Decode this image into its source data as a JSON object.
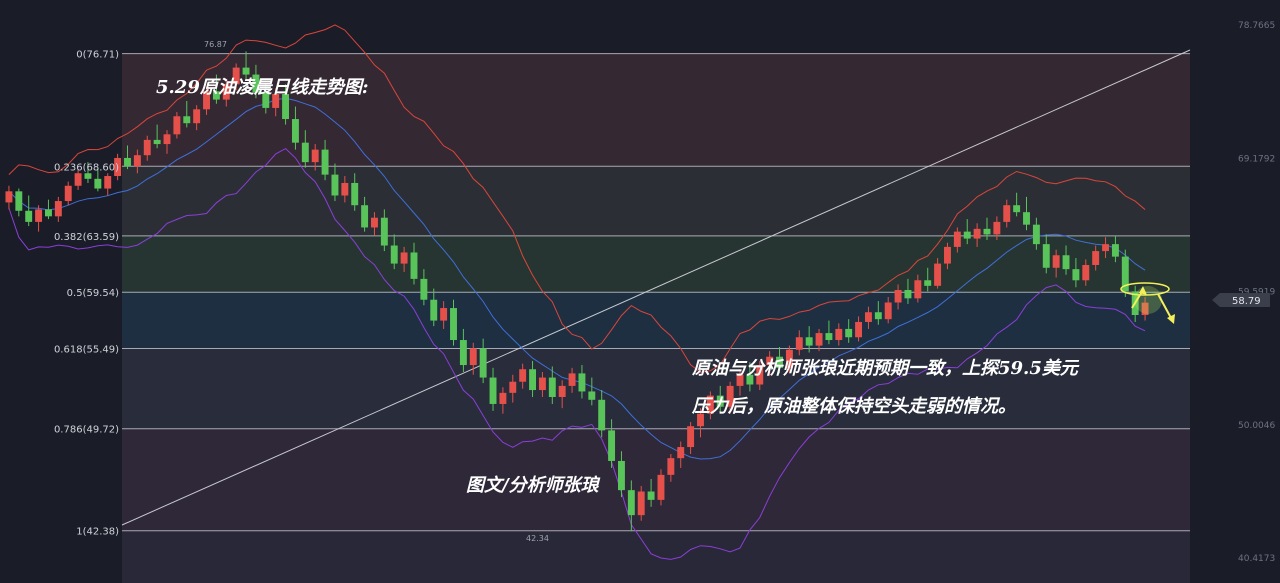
{
  "chart_data": {
    "type": "candlestick",
    "title": "5.29原油凌晨日线走势图:",
    "annotations": {
      "main_note_line1": "原油与分析师张琅近期预期一致，上探59.5美元",
      "main_note_line2": "压力后，原油整体保持空头走弱的情况。",
      "credit": "图文/分析师张琅",
      "high_label": "76.87",
      "low_label": "42.34"
    },
    "fib_levels": [
      {
        "label": "0(76.71)",
        "value": 76.71
      },
      {
        "label": "0.236(68.60)",
        "value": 68.6
      },
      {
        "label": "0.382(63.59)",
        "value": 63.59
      },
      {
        "label": "0.5(59.54)",
        "value": 59.54
      },
      {
        "label": "0.618(55.49)",
        "value": 55.49
      },
      {
        "label": "0.786(49.72)",
        "value": 49.72
      },
      {
        "label": "1(42.38)",
        "value": 42.38
      }
    ],
    "y_axis_ticks": [
      "78.7665",
      "69.1792",
      "59.5919",
      "50.0046",
      "40.4173"
    ],
    "y_tick_values": [
      78.7665,
      69.1792,
      59.5919,
      50.0046,
      40.4173
    ],
    "last_price": "58.79",
    "ylim": [
      40.4173,
      78.7665
    ],
    "candles": [
      [
        66.0,
        67.2,
        65.5,
        66.8
      ],
      [
        66.8,
        67.0,
        65.0,
        65.4
      ],
      [
        65.4,
        66.5,
        64.3,
        64.6
      ],
      [
        64.6,
        65.8,
        63.9,
        65.5
      ],
      [
        65.5,
        66.2,
        64.8,
        65.0
      ],
      [
        65.0,
        66.4,
        64.6,
        66.1
      ],
      [
        66.1,
        67.5,
        65.8,
        67.2
      ],
      [
        67.2,
        68.4,
        66.9,
        68.1
      ],
      [
        68.1,
        68.9,
        67.4,
        67.7
      ],
      [
        67.7,
        68.5,
        66.8,
        67.0
      ],
      [
        67.0,
        68.1,
        66.5,
        67.9
      ],
      [
        67.9,
        69.5,
        67.6,
        69.2
      ],
      [
        69.2,
        70.1,
        68.4,
        68.6
      ],
      [
        68.6,
        69.8,
        68.1,
        69.4
      ],
      [
        69.4,
        70.8,
        69.0,
        70.5
      ],
      [
        70.5,
        71.6,
        69.9,
        70.2
      ],
      [
        70.2,
        71.2,
        69.5,
        70.9
      ],
      [
        70.9,
        72.5,
        70.6,
        72.2
      ],
      [
        72.2,
        73.3,
        71.4,
        71.7
      ],
      [
        71.7,
        73.0,
        71.2,
        72.7
      ],
      [
        72.7,
        74.3,
        72.3,
        74.0
      ],
      [
        74.0,
        75.2,
        73.1,
        73.4
      ],
      [
        73.4,
        74.8,
        72.9,
        74.5
      ],
      [
        74.5,
        76.0,
        74.1,
        75.7
      ],
      [
        75.7,
        76.87,
        74.8,
        75.2
      ],
      [
        75.2,
        75.9,
        73.5,
        73.9
      ],
      [
        73.9,
        74.6,
        72.4,
        72.8
      ],
      [
        72.8,
        74.2,
        72.2,
        73.8
      ],
      [
        73.8,
        74.5,
        71.6,
        72.0
      ],
      [
        72.0,
        72.9,
        69.8,
        70.3
      ],
      [
        70.3,
        71.2,
        68.5,
        68.9
      ],
      [
        68.9,
        70.2,
        68.3,
        69.8
      ],
      [
        69.8,
        70.5,
        67.6,
        68.0
      ],
      [
        68.0,
        68.8,
        66.1,
        66.5
      ],
      [
        66.5,
        67.9,
        66.0,
        67.4
      ],
      [
        67.4,
        68.1,
        65.4,
        65.8
      ],
      [
        65.8,
        66.4,
        63.9,
        64.2
      ],
      [
        64.2,
        65.3,
        63.6,
        64.9
      ],
      [
        64.9,
        65.5,
        62.5,
        62.9
      ],
      [
        62.9,
        63.7,
        61.2,
        61.6
      ],
      [
        61.6,
        62.8,
        61.0,
        62.4
      ],
      [
        62.4,
        63.1,
        60.1,
        60.5
      ],
      [
        60.5,
        61.2,
        58.6,
        59.0
      ],
      [
        59.0,
        59.8,
        57.1,
        57.5
      ],
      [
        57.5,
        58.9,
        56.9,
        58.4
      ],
      [
        58.4,
        59.0,
        55.7,
        56.1
      ],
      [
        56.1,
        56.9,
        53.8,
        54.3
      ],
      [
        54.3,
        55.9,
        53.6,
        55.5
      ],
      [
        55.5,
        56.2,
        53.0,
        53.4
      ],
      [
        53.4,
        54.1,
        51.0,
        51.5
      ],
      [
        51.5,
        52.7,
        50.8,
        52.3
      ],
      [
        52.3,
        53.6,
        51.6,
        53.1
      ],
      [
        53.1,
        54.4,
        52.6,
        54.0
      ],
      [
        54.0,
        54.6,
        52.0,
        52.5
      ],
      [
        52.5,
        53.8,
        52.0,
        53.4
      ],
      [
        53.4,
        54.2,
        51.5,
        52.0
      ],
      [
        52.0,
        53.2,
        51.2,
        52.8
      ],
      [
        52.8,
        54.1,
        52.3,
        53.7
      ],
      [
        53.7,
        54.3,
        51.9,
        52.4
      ],
      [
        52.4,
        53.4,
        51.4,
        51.8
      ],
      [
        51.8,
        52.5,
        49.1,
        49.6
      ],
      [
        49.6,
        50.4,
        46.9,
        47.4
      ],
      [
        47.4,
        48.1,
        44.8,
        45.3
      ],
      [
        45.3,
        46.0,
        42.34,
        43.5
      ],
      [
        43.5,
        45.6,
        43.1,
        45.2
      ],
      [
        45.2,
        46.1,
        44.1,
        44.6
      ],
      [
        44.6,
        46.8,
        44.2,
        46.4
      ],
      [
        46.4,
        47.9,
        45.9,
        47.6
      ],
      [
        47.6,
        48.8,
        46.9,
        48.4
      ],
      [
        48.4,
        50.2,
        47.9,
        49.9
      ],
      [
        49.9,
        51.2,
        49.1,
        50.8
      ],
      [
        50.8,
        52.4,
        50.4,
        52.1
      ],
      [
        52.1,
        52.8,
        50.9,
        51.3
      ],
      [
        51.3,
        53.1,
        50.8,
        52.8
      ],
      [
        52.8,
        54.0,
        52.1,
        53.6
      ],
      [
        53.6,
        54.5,
        52.4,
        52.9
      ],
      [
        52.9,
        54.6,
        52.5,
        54.3
      ],
      [
        54.3,
        55.3,
        53.5,
        54.9
      ],
      [
        54.9,
        55.6,
        53.7,
        54.1
      ],
      [
        54.1,
        55.7,
        53.7,
        55.4
      ],
      [
        55.4,
        56.8,
        55.0,
        56.3
      ],
      [
        56.3,
        57.1,
        55.2,
        55.7
      ],
      [
        55.7,
        56.9,
        55.3,
        56.6
      ],
      [
        56.6,
        57.5,
        55.8,
        56.1
      ],
      [
        56.1,
        57.3,
        55.7,
        56.9
      ],
      [
        56.9,
        57.6,
        55.9,
        56.3
      ],
      [
        56.3,
        57.8,
        56.0,
        57.4
      ],
      [
        57.4,
        58.5,
        56.9,
        58.1
      ],
      [
        58.1,
        58.9,
        57.2,
        57.6
      ],
      [
        57.6,
        59.2,
        57.3,
        58.8
      ],
      [
        58.8,
        60.1,
        58.3,
        59.7
      ],
      [
        59.7,
        60.5,
        58.7,
        59.1
      ],
      [
        59.1,
        60.8,
        58.8,
        60.4
      ],
      [
        60.4,
        61.3,
        59.6,
        60.0
      ],
      [
        60.0,
        62.0,
        59.8,
        61.6
      ],
      [
        61.6,
        63.1,
        61.2,
        62.8
      ],
      [
        62.8,
        64.2,
        62.4,
        63.9
      ],
      [
        63.9,
        64.8,
        63.0,
        63.4
      ],
      [
        63.4,
        64.5,
        62.8,
        64.1
      ],
      [
        64.1,
        64.9,
        63.3,
        63.7
      ],
      [
        63.7,
        65.0,
        63.3,
        64.6
      ],
      [
        64.6,
        66.2,
        64.2,
        65.8
      ],
      [
        65.8,
        66.7,
        65.0,
        65.3
      ],
      [
        65.3,
        66.4,
        64.0,
        64.4
      ],
      [
        64.4,
        64.9,
        62.6,
        63.0
      ],
      [
        63.0,
        63.7,
        60.9,
        61.3
      ],
      [
        61.3,
        62.6,
        60.6,
        62.2
      ],
      [
        62.2,
        62.9,
        60.8,
        61.2
      ],
      [
        61.2,
        62.0,
        59.9,
        60.4
      ],
      [
        60.4,
        61.9,
        60.0,
        61.5
      ],
      [
        61.5,
        62.9,
        61.1,
        62.5
      ],
      [
        62.5,
        63.5,
        62.0,
        63.0
      ],
      [
        63.0,
        63.6,
        61.7,
        62.1
      ],
      [
        62.1,
        62.6,
        59.2,
        59.6
      ],
      [
        59.6,
        60.0,
        57.4,
        57.9
      ],
      [
        57.9,
        59.2,
        57.5,
        58.79
      ]
    ]
  }
}
